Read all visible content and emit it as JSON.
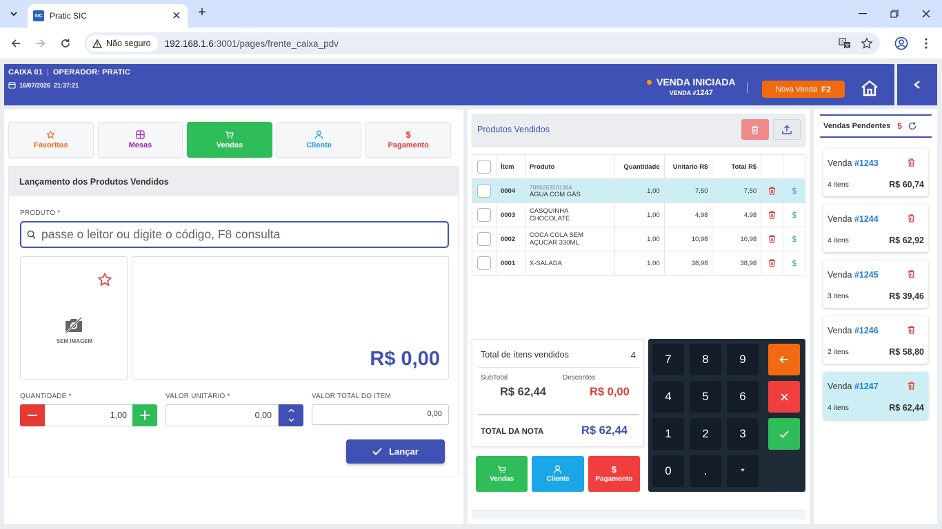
{
  "browser": {
    "tab_title": "Pratic SIC",
    "favicon_text": "SIC",
    "security_label": "Não seguro",
    "url_host": "192.168.1.6",
    "url_rest": ":3001/pages/frente_caixa_pdv"
  },
  "header": {
    "caixa": "CAIXA 01",
    "operador": "OPERADOR: PRATIC",
    "date": "16/07/2026",
    "time": "21:37:21",
    "status": "VENDA INICIADA",
    "venda_prefix": "VENDA #",
    "venda_number": "1247",
    "nova_venda_label": "Nova Venda",
    "nova_venda_key": "F2",
    "accent_color": "#3f51b5"
  },
  "tabs": [
    {
      "label": "Favoritos",
      "icon": "star-icon",
      "color": "#f26a10"
    },
    {
      "label": "Mesas",
      "icon": "table-grid-icon",
      "color": "#9c27b0"
    },
    {
      "label": "Vendas",
      "icon": "cart-icon",
      "color": "#ffffff"
    },
    {
      "label": "Cliente",
      "icon": "user-icon",
      "color": "#1e9ee0"
    },
    {
      "label": "Pagamento",
      "icon": "dollar-icon",
      "color": "#e53935"
    }
  ],
  "launch": {
    "title": "Lançamento dos Produtos Vendidos",
    "produto_label": "PRODUTO *",
    "search_placeholder": "passe o leitor ou digite o código, F8 consulta",
    "no_image": "SEM IMAGEM",
    "price": "R$ 0,00",
    "qty_label": "QUANTIDADE *",
    "qty_value": "1,00",
    "unit_label": "VALOR UNITÁRIO *",
    "unit_value": "0,00",
    "total_label": "VALOR TOTAL DO ITEM",
    "total_value": "0,00",
    "lancar_label": "Lançar"
  },
  "products": {
    "title": "Produtos Vendidos",
    "columns": {
      "item": "Ítem",
      "produto": "Produto",
      "qtd": "Quantidade",
      "unit": "Unitário R$",
      "total": "Total R$"
    },
    "rows": [
      {
        "item": "0004",
        "code": "7896263501384",
        "name": "ÁGUA COM GÁS",
        "qtd": "1,00",
        "unit": "7,50",
        "total": "7,50"
      },
      {
        "item": "0003",
        "code": "",
        "name": "CASQUINHA CHOCOLATE",
        "qtd": "1,00",
        "unit": "4,98",
        "total": "4,98"
      },
      {
        "item": "0002",
        "code": "",
        "name": "COCA COLA SEM AÇUCAR 330ML",
        "qtd": "1,00",
        "unit": "10,98",
        "total": "10,98"
      },
      {
        "item": "0001",
        "code": "",
        "name": "X-SALADA",
        "qtd": "1,00",
        "unit": "38,98",
        "total": "38,98"
      }
    ]
  },
  "totals": {
    "items_label": "Total de ítens vendidos",
    "items_count": "4",
    "subtotal_label": "SubTotal",
    "subtotal": "R$ 62,44",
    "desc_label": "Descontos",
    "desc": "R$ 0,00",
    "nota_label": "TOTAL DA NOTA",
    "nota": "R$ 62,44"
  },
  "bottom_buttons": [
    "Vendas",
    "Cliente",
    "Pagamento"
  ],
  "keypad": [
    "7",
    "8",
    "9",
    "4",
    "5",
    "6",
    "1",
    "2",
    "3",
    "0",
    ".",
    "*"
  ],
  "pending": {
    "title": "Vendas Pendentes",
    "count": "5",
    "venda_word": "Venda",
    "sales": [
      {
        "num": "#1243",
        "items": "4 itens",
        "value": "R$ 60,74"
      },
      {
        "num": "#1244",
        "items": "4 itens",
        "value": "R$ 62,92"
      },
      {
        "num": "#1245",
        "items": "3 itens",
        "value": "R$ 39,46"
      },
      {
        "num": "#1246",
        "items": "2 itens",
        "value": "R$ 58,80"
      },
      {
        "num": "#1247",
        "items": "4 itens",
        "value": "R$ 62,44"
      }
    ]
  }
}
